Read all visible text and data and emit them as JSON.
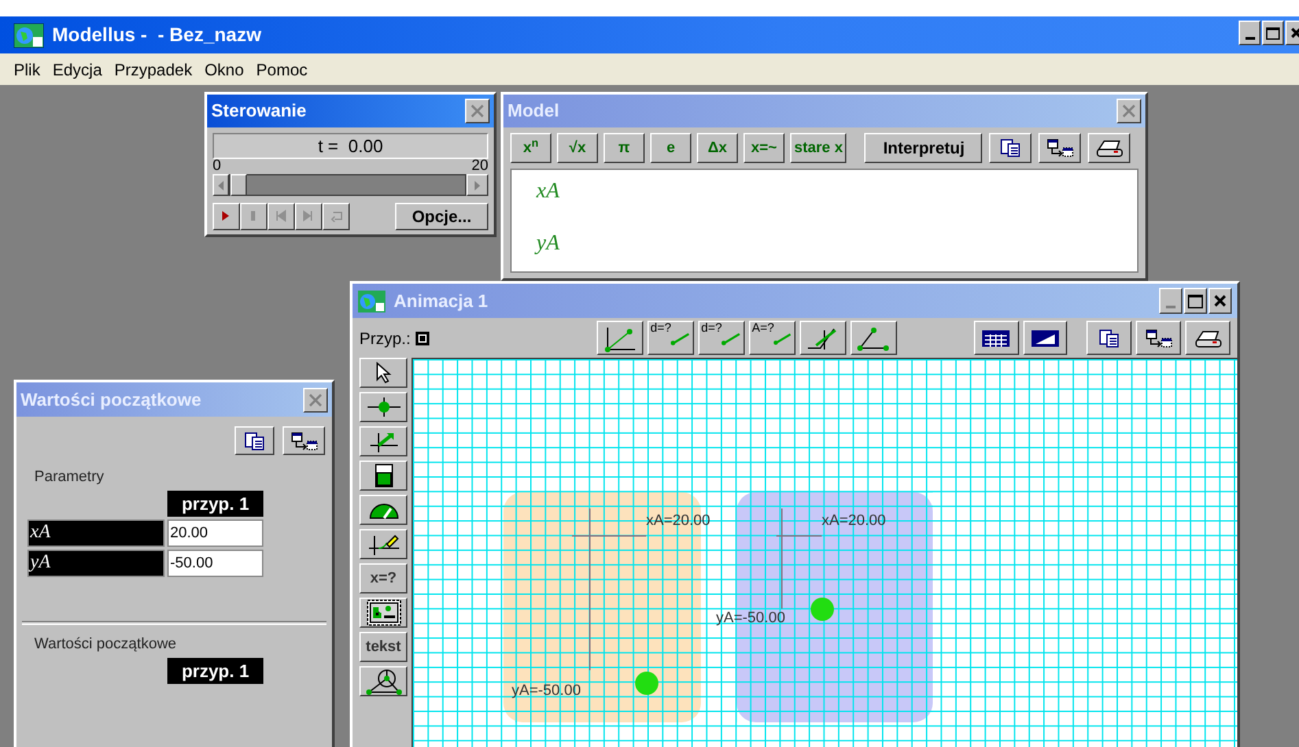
{
  "app": {
    "title": "Modellus -  - Bez_nazw"
  },
  "menu": [
    "Plik",
    "Edycja",
    "Przypadek",
    "Okno",
    "Pomoc"
  ],
  "control": {
    "title": "Sterowanie",
    "active": true,
    "time": "t =  0.00",
    "slider_min": "0",
    "slider_max": "20",
    "level": 0,
    "options_button": "Opcje..."
  },
  "model": {
    "title": "Model",
    "active": false,
    "buttons": [
      {
        "kind": "math",
        "label": "x$^{n}$"
      },
      {
        "kind": "math",
        "label": "√x"
      },
      {
        "kind": "math",
        "label": "π"
      },
      {
        "kind": "math",
        "label": "e"
      },
      {
        "kind": "math",
        "label": "Δx"
      },
      {
        "kind": "math",
        "label": "x=~"
      },
      {
        "kind": "math",
        "label": "stare x"
      },
      {
        "kind": "text",
        "label": "Interpretuj"
      },
      {
        "kind": "copy"
      },
      {
        "kind": "export"
      },
      {
        "kind": "print"
      }
    ],
    "equations": [
      "xA",
      "yA"
    ]
  },
  "animation": {
    "title": "Animacja 1",
    "active": false,
    "case_label": "Przyp.:",
    "tools": [
      {
        "kind": "axes"
      },
      {
        "kind": "measure",
        "label": "d=?"
      },
      {
        "kind": "path",
        "label": "d=?"
      },
      {
        "kind": "area",
        "label": "A=?"
      },
      {
        "kind": "slope"
      },
      {
        "kind": "angle"
      },
      {
        "kind": "table"
      },
      {
        "kind": "graph"
      },
      {
        "kind": "copy"
      },
      {
        "kind": "export"
      },
      {
        "kind": "print"
      }
    ],
    "palette": [
      {
        "kind": "pointer"
      },
      {
        "kind": "particle"
      },
      {
        "kind": "vector"
      },
      {
        "kind": "level"
      },
      {
        "kind": "gauge"
      },
      {
        "kind": "pen"
      },
      {
        "kind": "text",
        "label": "x=?"
      },
      {
        "kind": "image"
      },
      {
        "kind": "text",
        "label": "tekst"
      },
      {
        "kind": "geometry"
      }
    ],
    "objects": [
      {
        "color": "#fde2bc",
        "x_label": "xA=20.00",
        "y_label": "yA=-50.00"
      },
      {
        "color": "#c8c8f8",
        "x_label": "xA=20.00",
        "y_label": "yA=-50.00"
      }
    ]
  },
  "initial": {
    "title": "Wartości początkowe",
    "active": false,
    "parameters_label": "Parametry",
    "column": "przyp. 1",
    "rows": [
      {
        "name": "xA",
        "value": "20.00"
      },
      {
        "name": "yA",
        "value": "-50.00"
      }
    ],
    "initial_label": "Wartości początkowe",
    "initial_column": "przyp. 1"
  }
}
